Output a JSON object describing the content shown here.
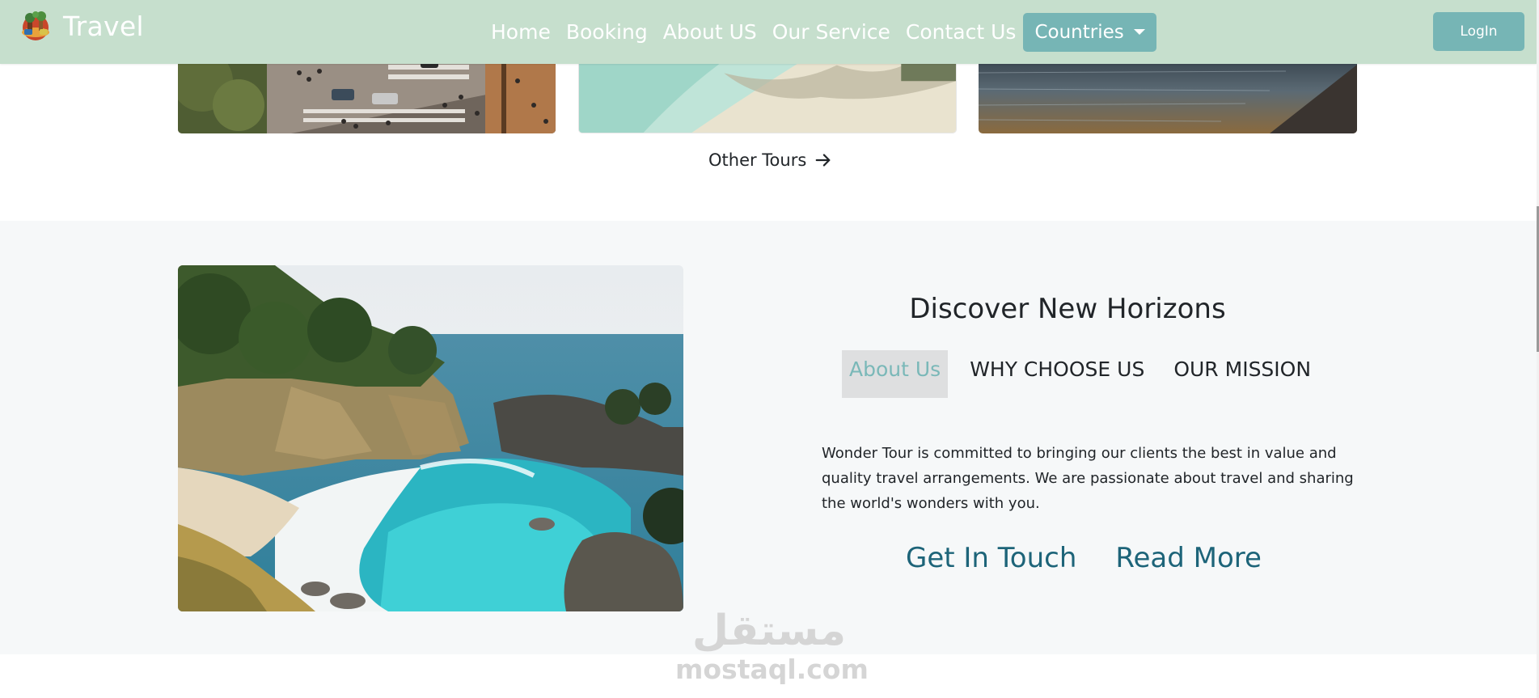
{
  "navbar": {
    "brand": "Travel",
    "links": [
      "Home",
      "Booking",
      "About US",
      "Our Service",
      "Contact Us"
    ],
    "countries_label": "Countries",
    "login_label": "LogIn"
  },
  "tours": {
    "other_tours_label": "Other Tours"
  },
  "about": {
    "title": "Discover New Horizons",
    "tabs": [
      "About Us",
      "WHY CHOOSE US",
      "OUR MISSION"
    ],
    "active_tab": "About Us",
    "text": "Wonder Tour is committed to bringing our clients the best in value and quality travel arrangements. We are passionate about travel and sharing the world's wonders with you.",
    "get_in_touch": "Get In Touch",
    "read_more": "Read More"
  },
  "watermark": {
    "arabic": "مستقل",
    "latin": "mostaql.com"
  },
  "colors": {
    "navbar_bg": "#c6dfcd",
    "button_accent": "#76b5b5",
    "active_tab_text": "#7ab8b8",
    "link_dark_teal": "#1d6479",
    "section_bg": "#f6f8f9"
  }
}
